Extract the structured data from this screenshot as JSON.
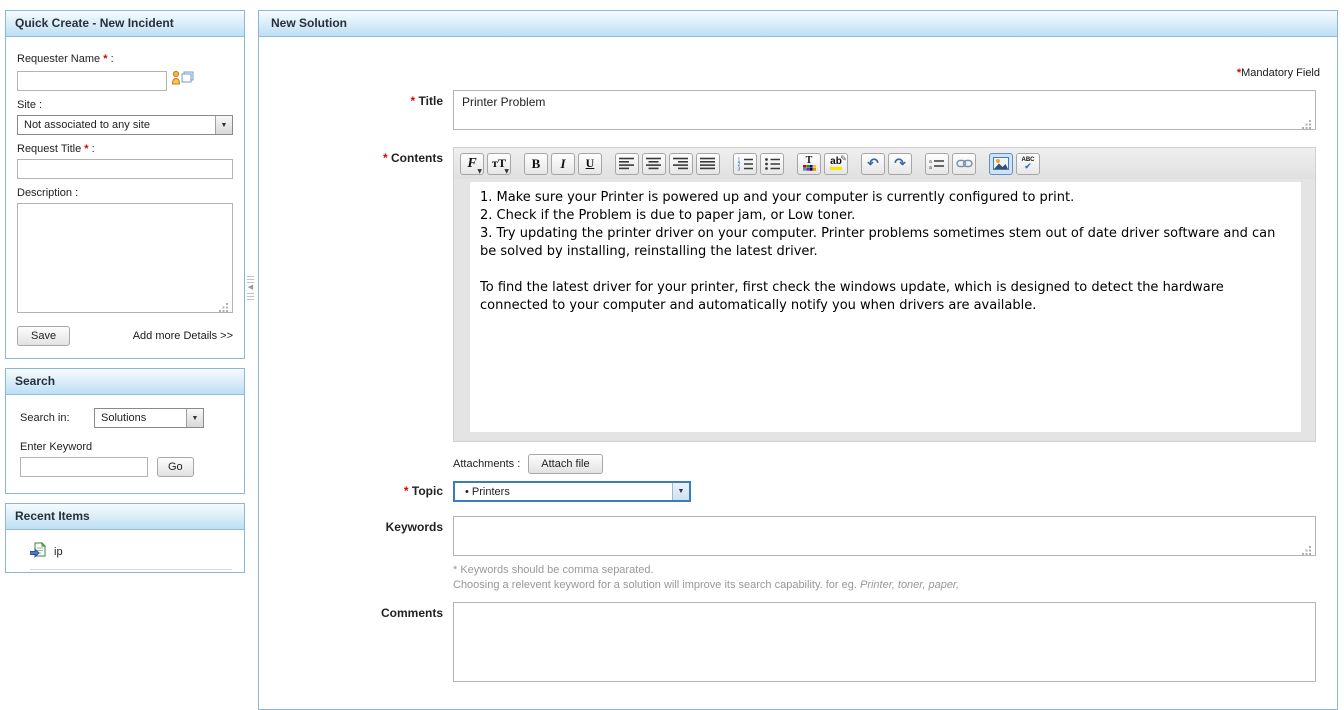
{
  "star": "*",
  "colon": ":",
  "colors": {
    "panel_border": "#8ab6dc",
    "header_gradient_top": "#f7fbfe",
    "header_gradient_bottom": "#bcdff2",
    "header_text": "#26303b",
    "mandatory_red": "#e00000",
    "topic_focus_border": "#3b7bbf",
    "help_text": "#989898",
    "highlight_yellow": "#ffe400"
  },
  "sidebar": {
    "quick_create": {
      "title": "Quick Create - New Incident",
      "requester_name_label": "Requester Name",
      "site_label": "Site :",
      "site_value": "Not associated to any site",
      "request_title_label": "Request Title",
      "description_label": "Description :",
      "save_button": "Save",
      "add_more_details_link": "Add more Details >>"
    },
    "search": {
      "title": "Search",
      "search_in_label": "Search in:",
      "search_in_value": "Solutions",
      "enter_keyword_label": "Enter Keyword",
      "go_button": "Go"
    },
    "recent_items": {
      "title": "Recent Items",
      "items": [
        {
          "label": "ip",
          "icon": "solution-document-icon"
        }
      ]
    }
  },
  "main": {
    "title": "New Solution",
    "mandatory_note": "Mandatory Field",
    "title_field": {
      "label": "Title",
      "value": "Printer Problem"
    },
    "contents_field": {
      "label": "Contents",
      "value": "1. Make sure your Printer is powered up and your computer is currently configured to print.\n2. Check if the Problem is due to paper jam, or Low toner.\n3. Try updating the printer driver on your computer. Printer problems sometimes stem out of date driver software and can be solved by installing, reinstalling the latest driver.\n\nTo find the latest driver for your printer, first check the windows update, which is designed to detect the hardware connected to your computer and automatically notify you when drivers are available."
    },
    "toolbar": {
      "font_family": "F",
      "font_size": "тT",
      "bold": "B",
      "italic": "I",
      "underline": "U",
      "font_color": "T",
      "highlight": "ab",
      "undo": "↶",
      "redo": "↷",
      "spellcheck": "ABC",
      "icon_names": [
        "font-family",
        "font-size",
        "bold",
        "italic",
        "underline",
        "align-left",
        "align-center",
        "align-right",
        "justify",
        "ordered-list",
        "unordered-list",
        "font-color",
        "highlight",
        "undo",
        "redo",
        "insert-hr",
        "insert-link",
        "insert-image",
        "spellcheck"
      ]
    },
    "attachments": {
      "label": "Attachments :",
      "attach_button": "Attach file"
    },
    "topic_field": {
      "label": "Topic",
      "bullet": "•",
      "value": "Printers"
    },
    "keywords_field": {
      "label": "Keywords",
      "value": "",
      "help_line1": "* Keywords should be comma separated.",
      "help_line2": "Choosing a relevent keyword for a solution will improve its search capability. for eg. ",
      "help_line2_examples": "Printer, toner, paper,"
    },
    "comments_field": {
      "label": "Comments",
      "value": ""
    }
  }
}
